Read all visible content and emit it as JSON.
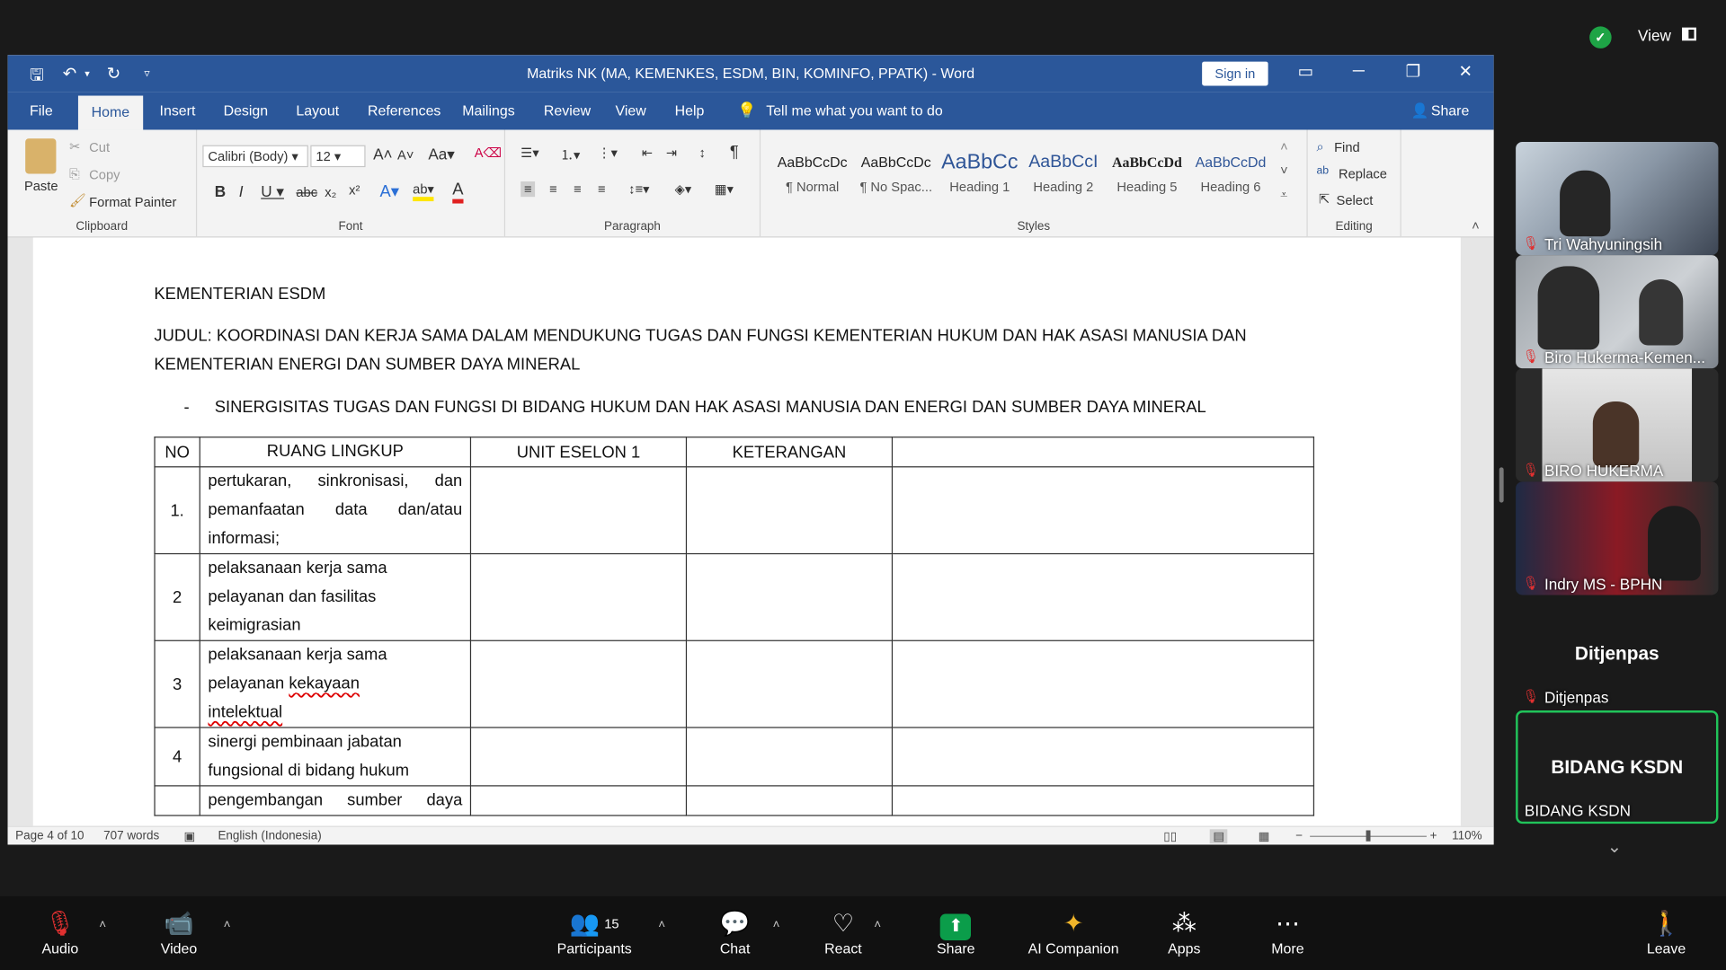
{
  "zoom_top": {
    "view_label": "View",
    "shield_icon": "shield-check-icon"
  },
  "word": {
    "title": "Matriks NK (MA, KEMENKES, ESDM, BIN, KOMINFO, PPATK)  -  Word",
    "sign_in": "Sign in",
    "tabs": [
      "File",
      "Home",
      "Insert",
      "Design",
      "Layout",
      "References",
      "Mailings",
      "Review",
      "View",
      "Help"
    ],
    "tell_me": "Tell me what you want to do",
    "share": "Share",
    "clipboard": {
      "paste": "Paste",
      "cut": "Cut",
      "copy": "Copy",
      "format_painter": "Format Painter",
      "label": "Clipboard"
    },
    "font": {
      "name": "Calibri (Body)",
      "size": "12",
      "label": "Font"
    },
    "paragraph": {
      "label": "Paragraph"
    },
    "styles": {
      "label": "Styles",
      "items": [
        {
          "preview": "AaBbCcDc",
          "name": "¶ Normal"
        },
        {
          "preview": "AaBbCcDc",
          "name": "¶ No Spac..."
        },
        {
          "preview": "AaBbCc",
          "name": "Heading 1"
        },
        {
          "preview": "AaBbCcI",
          "name": "Heading 2"
        },
        {
          "preview": "AaBbCcDd",
          "name": "Heading 5"
        },
        {
          "preview": "AaBbCcDd",
          "name": "Heading 6"
        }
      ]
    },
    "editing": {
      "find": "Find",
      "replace": "Replace",
      "select": "Select",
      "label": "Editing"
    },
    "doc": {
      "heading": "KEMENTERIAN ESDM",
      "judul_line1": "JUDUL: KOORDINASI DAN KERJA SAMA DALAM MENDUKUNG TUGAS DAN FUNGSI KEMENTERIAN HUKUM DAN HAK ASASI MANUSIA DAN",
      "judul_line2": "KEMENTERIAN ENERGI DAN SUMBER DAYA MINERAL",
      "bullet_dash": "-",
      "bullet": "SINERGISITAS TUGAS DAN FUNGSI DI BIDANG HUKUM DAN HAK ASASI MANUSIA DAN ENERGI DAN SUMBER DAYA MINERAL",
      "table_headers": [
        "NO",
        "RUANG LINGKUP",
        "UNIT ESELON 1",
        "KETERANGAN",
        ""
      ],
      "rows": [
        {
          "no": "1.",
          "lines": [
            "pertukaran, sinkronisasi, dan",
            "pemanfaatan data dan/atau",
            "informasi;"
          ]
        },
        {
          "no": "2",
          "lines": [
            "pelaksanaan kerja sama",
            "pelayanan dan fasilitas",
            "keimigrasian"
          ]
        },
        {
          "no": "3",
          "lines": [
            "pelaksanaan kerja sama",
            "pelayanan kekayaan",
            "intelektual"
          ]
        },
        {
          "no": "4",
          "lines": [
            "sinergi pembinaan jabatan",
            "fungsional di bidang hukum"
          ]
        },
        {
          "no": "",
          "lines": [
            "pengembangan sumber daya"
          ]
        }
      ]
    },
    "status": {
      "page": "Page 4 of 10",
      "words": "707 words",
      "language": "English (Indonesia)",
      "zoom": "110%"
    }
  },
  "participants": [
    {
      "name": "Tri Wahyuningsih"
    },
    {
      "name": "Biro Hukerma-Kemen..."
    },
    {
      "name": "BIRO HUKERMA"
    },
    {
      "name": "Indry MS - BPHN"
    },
    {
      "name": "Ditjenpas",
      "big": "Ditjenpas"
    },
    {
      "name": "BIDANG KSDN",
      "big": "BIDANG KSDN"
    }
  ],
  "toolbar": {
    "audio": "Audio",
    "video": "Video",
    "participants": "Participants",
    "participants_count": "15",
    "chat": "Chat",
    "react": "React",
    "share": "Share",
    "ai": "AI Companion",
    "apps": "Apps",
    "more": "More",
    "leave": "Leave"
  },
  "colors": {
    "word_blue": "#2b579a",
    "zoom_green": "#0b9d4a",
    "active_speaker": "#21c45a"
  }
}
